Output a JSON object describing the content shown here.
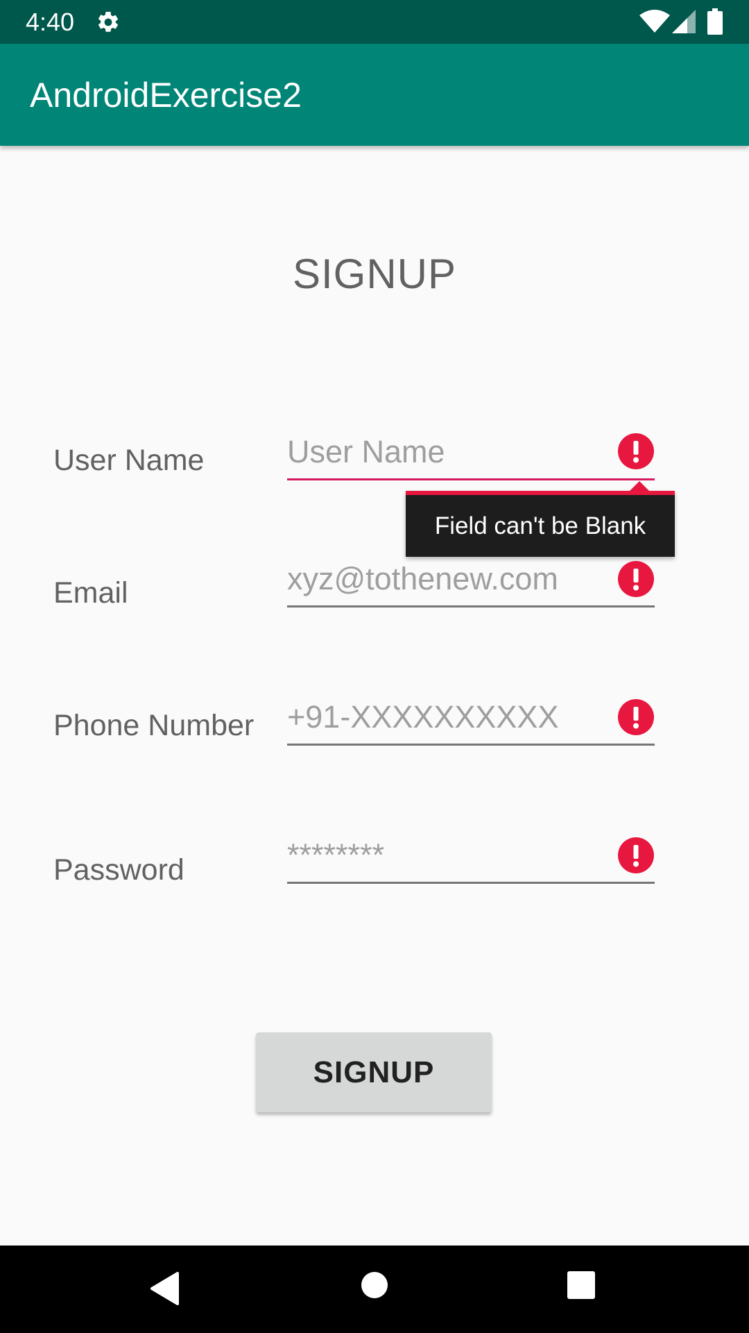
{
  "status_bar": {
    "time": "4:40",
    "icons": [
      "gear-icon",
      "wifi-icon",
      "signal-icon",
      "battery-icon"
    ]
  },
  "app_bar": {
    "title": "AndroidExercise2"
  },
  "form": {
    "heading": "SIGNUP",
    "fields": [
      {
        "label": "User Name",
        "placeholder": "User Name",
        "has_error": true
      },
      {
        "label": "Email",
        "placeholder": "xyz@tothenew.com",
        "has_error": true
      },
      {
        "label": "Phone Number",
        "placeholder": "+91-XXXXXXXXXX",
        "has_error": true
      },
      {
        "label": "Password",
        "placeholder": "********",
        "has_error": true
      }
    ],
    "error_tooltip": "Field can't be Blank",
    "submit_label": "SIGNUP"
  },
  "nav_bar": {
    "icons": [
      "back-icon",
      "home-icon",
      "recents-icon"
    ]
  },
  "colors": {
    "status_bar": "#00574b",
    "app_bar": "#008577",
    "error": "#e8173f",
    "active_underline": "#d81b60",
    "button": "#d6d7d7"
  }
}
